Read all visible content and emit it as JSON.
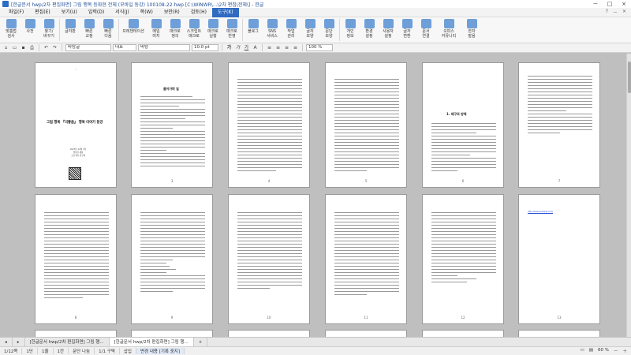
{
  "window": {
    "title": "[한글문서 hwp/2차 편집화면] 그림 행복 등화현 전체 (모바일 동강) 100108-22.hwp [C:\\WINWR\\...\\2차 편집\\전체\\] - 한글",
    "controls": [
      "－",
      "□",
      "×"
    ]
  },
  "menu": {
    "items": [
      "파일(F)",
      "편집(E)",
      "보기(U)",
      "입력(D)",
      "서식(J)",
      "쪽(W)",
      "보안(R)",
      "검토(H)",
      "도구(K)"
    ],
    "active_index": 8,
    "right_tools": [
      "?",
      "－",
      "×"
    ]
  },
  "ribbon": {
    "buttons": [
      "맞춤법\n검사",
      "사전",
      "찾기/\n바꾸기",
      "글자판",
      "빠른\n교정",
      "빠른\n다음",
      "프레젠테이션",
      "메일\n머지",
      "매크로\n정의",
      "스크립트\n매크로",
      "매크로\n실행",
      "매크로\n반영",
      "블로그",
      "SNS\n서비스",
      "작업\n관리",
      "글자\n모양",
      "문단\n모양",
      "개인\n정보",
      "환경\n설정",
      "사용자\n설정",
      "글자\n변환",
      "문서\n연결",
      "오피스\n커뮤니티",
      "한자\n발음"
    ]
  },
  "format_toolbar": {
    "style": "바탕글",
    "language": "대표",
    "font": "바탕",
    "size": "10.0 pt",
    "zoom": "100 %"
  },
  "pages": {
    "row1": [
      {
        "kind": "cover",
        "title": "그림 행복 『의좋음』 행복 이야기 동강",
        "info": [
          "2023년 12월 1일",
          "행복한 세상",
          "그림 행복 연구회"
        ]
      },
      {
        "kind": "body",
        "headline": "들어가며 일",
        "number": "3"
      },
      {
        "kind": "body",
        "headline": "",
        "number": "4"
      },
      {
        "kind": "body",
        "headline": "",
        "number": "5"
      },
      {
        "kind": "body",
        "headline": "1. 제구의 방체",
        "number": "6"
      },
      {
        "kind": "body",
        "headline": "",
        "number": "7"
      }
    ],
    "row2": [
      {
        "number": "8"
      },
      {
        "number": "9"
      },
      {
        "number": "10"
      },
      {
        "number": "11"
      },
      {
        "number": "12"
      },
      {
        "number": "13",
        "link": "http://www.example.com/"
      }
    ]
  },
  "doc_tabs": [
    {
      "label": "[한글문서 hwp/2차 편집화면] 그림 행...",
      "active": false
    },
    {
      "label": "[한글문서 hwp/2차 편집화면] 그림 행...",
      "active": true
    }
  ],
  "status": {
    "page": "1/12쪽",
    "section": "1단",
    "line": "1줄",
    "col": "1칸",
    "chars": "문단 나눔",
    "position": "1/1 구역",
    "mode": "삽입",
    "change": "변경 내용 [기록 중지]",
    "zoom": "60 %"
  },
  "colors": {
    "accent": "#2f6bc1",
    "title_text": "#1f4e96",
    "link": "#2b4fd6"
  }
}
